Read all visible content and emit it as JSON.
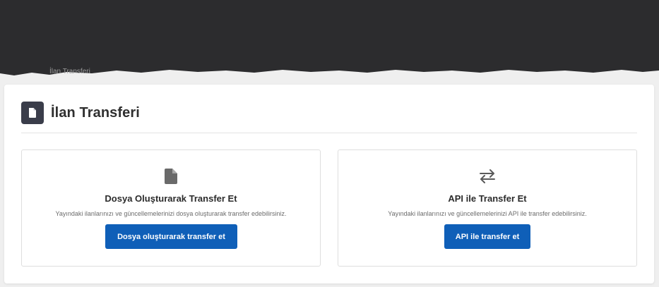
{
  "breadcrumb": {
    "current": "İlan Transferi"
  },
  "page": {
    "title": "İlan Transferi"
  },
  "cards": [
    {
      "icon": "file-icon",
      "title": "Dosya Oluşturarak Transfer Et",
      "description": "Yayındaki ilanlarınızı ve güncellemelerinizi dosya oluşturarak transfer edebilirsiniz.",
      "button_label": "Dosya oluşturarak transfer et"
    },
    {
      "icon": "transfer-arrows-icon",
      "title": "API ile Transfer Et",
      "description": "Yayındaki ilanlarınızı ve güncellemelerinizi API ile transfer edebilirsiniz.",
      "button_label": "API ile transfer et"
    }
  ],
  "colors": {
    "primary_button": "#0f5fb8",
    "title_icon_bg": "#3a3d4a",
    "top_band": "#2c2c2e"
  }
}
